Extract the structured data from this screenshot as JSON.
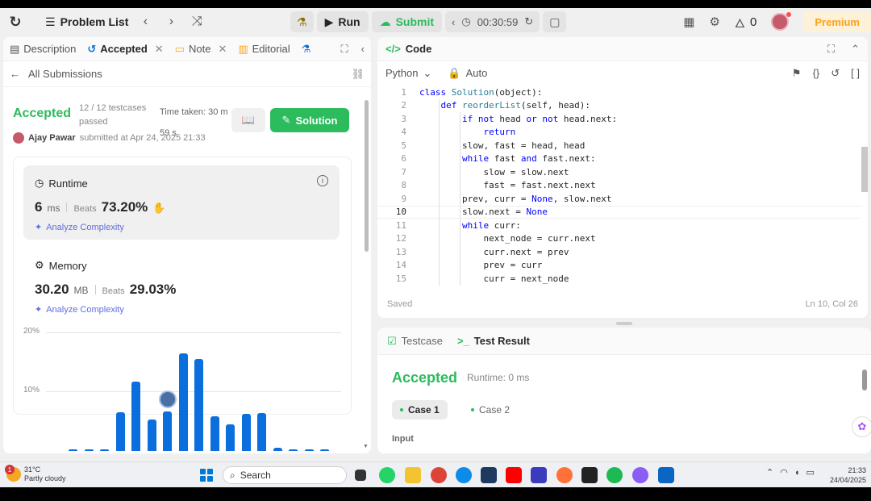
{
  "topbar": {
    "problem_list": "Problem List",
    "run": "Run",
    "submit": "Submit",
    "timer": "00:30:59",
    "streak": "0",
    "premium": "Premium"
  },
  "left": {
    "tabs": [
      {
        "label": "Description"
      },
      {
        "label": "Accepted"
      },
      {
        "label": "Note"
      },
      {
        "label": "Editorial"
      }
    ],
    "all_submissions": "All Submissions",
    "status": "Accepted",
    "testcases": "12 / 12 testcases passed",
    "time_taken": "Time taken: 30 m 59 s",
    "solution_btn": "Solution",
    "user": "Ajay Pawar",
    "submitted_at": "submitted at Apr 24, 2025 21:33",
    "runtime": {
      "title": "Runtime",
      "value": "6",
      "unit": "ms",
      "beats_label": "Beats",
      "beats": "73.20%",
      "analyze": "Analyze Complexity"
    },
    "memory": {
      "title": "Memory",
      "value": "30.20",
      "unit": "MB",
      "beats_label": "Beats",
      "beats": "29.03%",
      "analyze": "Analyze Complexity"
    }
  },
  "chart_data": {
    "type": "bar",
    "y_ticks": [
      "20%",
      "10%"
    ],
    "ylim": [
      0,
      20
    ],
    "values": [
      0.3,
      0.3,
      0.3,
      6.5,
      11.7,
      5.3,
      6.6,
      16.5,
      15.5,
      5.8,
      4.5,
      6.2,
      6.4,
      0.6,
      0.3,
      0.3,
      0.3
    ],
    "highlight_index": 6
  },
  "code": {
    "title": "Code",
    "language": "Python",
    "mode": "Auto",
    "lines": [
      "class Solution(object):",
      "    def reorderList(self, head):",
      "        if not head or not head.next:",
      "            return",
      "        slow, fast = head, head",
      "        while fast and fast.next:",
      "            slow = slow.next",
      "            fast = fast.next.next",
      "        prev, curr = None, slow.next",
      "        slow.next = None",
      "        while curr:",
      "            next_node = curr.next",
      "            curr.next = prev",
      "            prev = curr",
      "            curr = next_node"
    ],
    "line_numbers": [
      "1",
      "2",
      "3",
      "4",
      "5",
      "6",
      "7",
      "8",
      "9",
      "10",
      "11",
      "12",
      "13",
      "14",
      "15"
    ],
    "status": "Saved",
    "cursor": "Ln 10, Col 26"
  },
  "test": {
    "tab_testcase": "Testcase",
    "tab_result": "Test Result",
    "status": "Accepted",
    "runtime": "Runtime: 0 ms",
    "case1": "Case 1",
    "case2": "Case 2",
    "input_label": "Input"
  },
  "taskbar": {
    "temp": "31°C",
    "weather": "Partly cloudy",
    "notif": "1",
    "search": "Search",
    "time": "21:33",
    "date": "24/04/2025"
  },
  "colors": {
    "accent_green": "#2cbb5d",
    "bar_blue": "#0a6fdc",
    "premium_orange": "#ffa116"
  }
}
